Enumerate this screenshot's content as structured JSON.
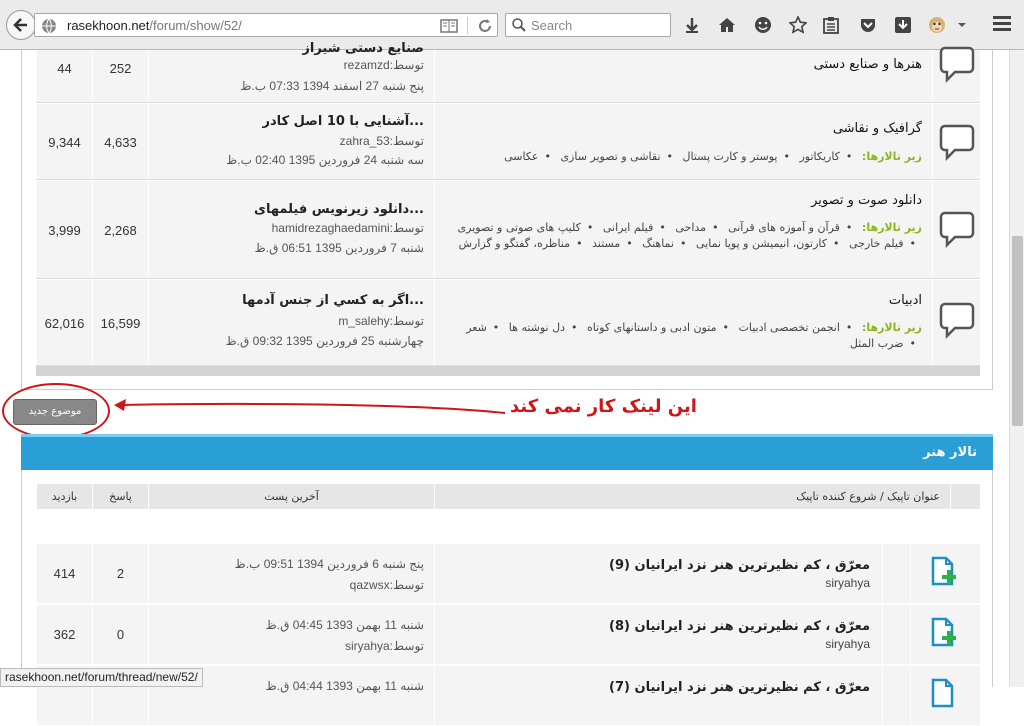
{
  "browser": {
    "url_domain": "rasekhoon.net",
    "url_path": "/forum/show/52/",
    "search_placeholder": "Search",
    "status_url": "rasekhoon.net/forum/thread/new/52/"
  },
  "forums": [
    {
      "views": "44",
      "replies": "252",
      "last_title": "صنایع دستی شیراز",
      "last_by": "rezamzd:توسط",
      "last_date": "پنج شنبه 27 اسفند 1394   07:33 ب.ظ",
      "title": "هنرها و صنایع دستی",
      "subforums": []
    },
    {
      "views": "9,344",
      "replies": "4,633",
      "last_title": "...آشنایی با 10 اصل کادر",
      "last_by": "zahra_53:توسط",
      "last_date": "سه شنبه 24 فروردین 1395   02:40 ب.ظ",
      "title": "گرافیک و نقاشی",
      "subforums_label": "زیر تالارها:",
      "subforums": [
        "کاریکاتور",
        "پوستر و کارت پستال",
        "نقاشی و تصویر سازی",
        "عکاسی"
      ]
    },
    {
      "views": "3,999",
      "replies": "2,268",
      "last_title": "...دانلود زیرنویس فیلمهای",
      "last_by": "hamidrezaghaedamini:توسط",
      "last_date": "شنبه 7 فروردین 1395   06:51 ق.ظ",
      "title": "دانلود صوت و تصویر",
      "subforums_label": "زیر تالارها:",
      "subforums": [
        "قرآن و آموزه های قرآنی",
        "مداحی",
        "فیلم ایرانی",
        "کلیپ های صوتی و تصویری",
        "فیلم خارجی",
        "کارتون، انیمیشن و پویا نمایی",
        "نماهنگ",
        "مستند",
        "مناظره، گفتگو و گزارش"
      ]
    },
    {
      "views": "62,016",
      "replies": "16,599",
      "last_title": "...اگر به کسي از جنس آدمها",
      "last_by": "m_salehy:توسط",
      "last_date": "چهارشنبه 25 فروردین 1395   09:32 ق.ظ",
      "title": "ادبیات",
      "subforums_label": "زیر تالارها:",
      "subforums": [
        "انجمن تخصصی ادبیات",
        "متون ادبی و داستانهای کوتاه",
        "دل نوشته ها",
        "شعر",
        "ضرب المثل"
      ]
    }
  ],
  "new_topic_label": "موضوع جدید",
  "annotation_text": "این لینک کار نمی کند",
  "section_title": "تالار هنر",
  "table_headers": {
    "title": "عنوان تاپیک / شروع کننده تاپیک",
    "last_post": "آخرین پست",
    "replies": "پاسخ",
    "views": "بازدید"
  },
  "threads": [
    {
      "title": "معرّق ، کم نظیرترین هنر نزد ایرانیان (9)",
      "starter": "siryahya",
      "last_date": "پنج شنبه 6 فروردین 1394   09:51 ب.ظ",
      "last_by": "qazwsx:توسط",
      "replies": "2",
      "views": "414"
    },
    {
      "title": "معرّق ، کم نظیرترین هنر نزد ایرانیان (8)",
      "starter": "siryahya",
      "last_date": "شنبه 11 بهمن 1393   04:45 ق.ظ",
      "last_by": "siryahya:توسط",
      "replies": "0",
      "views": "362"
    },
    {
      "title": "معرّق ، کم نظیرترین هنر نزد ایرانیان (7)",
      "starter": "",
      "last_date": "شنبه 11 بهمن 1393   04:44 ق.ظ",
      "last_by": "",
      "replies": "",
      "views": ""
    }
  ],
  "colors": {
    "section_header": "#2a9fd6",
    "subforum_label": "#8bb51e",
    "annotation": "#d0141a",
    "new_thread_icon": "#1e8fc6"
  }
}
